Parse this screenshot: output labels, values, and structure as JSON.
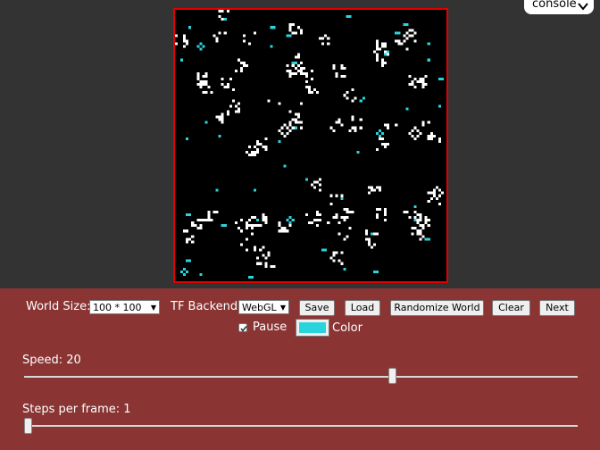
{
  "console": {
    "label": "console",
    "icon": "chevron-down-icon"
  },
  "world": {
    "border_color": "#e00000",
    "background": "#000000",
    "cell_colors": {
      "alive": "#ffffff",
      "new": "#2ad4dc"
    }
  },
  "controls": {
    "background": "#8a3434",
    "world_size": {
      "label": "World Size:",
      "value": "100 * 100"
    },
    "backend": {
      "label": "TF Backend:",
      "value": "WebGL"
    },
    "buttons": {
      "save": "Save",
      "load": "Load",
      "randomize": "Randomize World",
      "clear": "Clear",
      "next": "Next"
    },
    "pause": {
      "label": "Pause",
      "checked": true
    },
    "color": {
      "label": "Color",
      "value": "#2ad4dc"
    },
    "speed": {
      "label": "Speed: 20",
      "value": 20
    },
    "steps": {
      "label": "Steps per frame: 1",
      "value": 1
    }
  }
}
